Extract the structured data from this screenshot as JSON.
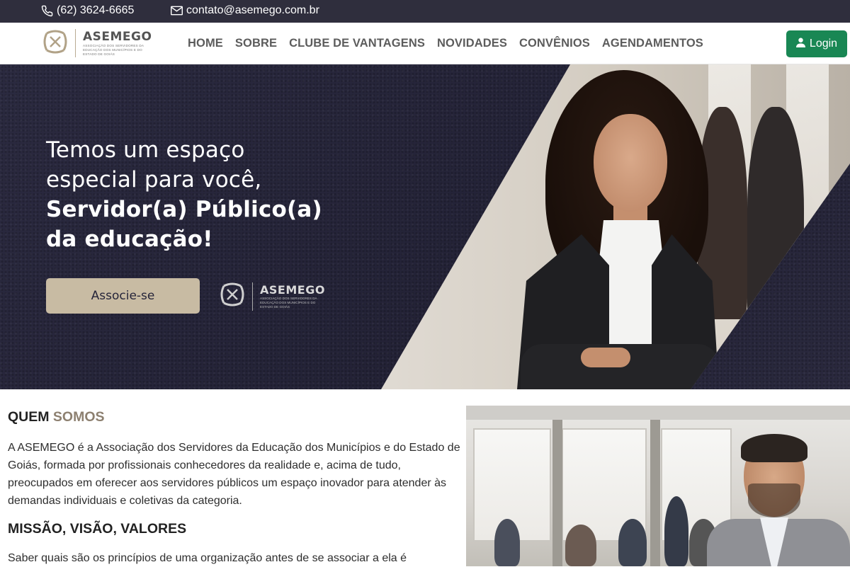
{
  "topbar": {
    "phone": "(62) 3624-6665",
    "email": "contato@asemego.com.br",
    "phone_icon": "phone-icon",
    "email_icon": "envelope-icon"
  },
  "nav": {
    "logo_name": "ASEMEGO",
    "logo_sub": "Associação dos Servidores da Educação dos Municípios e do Estado de Goiás",
    "items": [
      {
        "label": "HOME"
      },
      {
        "label": "SOBRE"
      },
      {
        "label": "CLUBE DE VANTAGENS"
      },
      {
        "label": "NOVIDADES"
      },
      {
        "label": "CONVÊNIOS"
      },
      {
        "label": "AGENDAMENTOS"
      }
    ],
    "login_label": "Login",
    "login_icon": "user-icon"
  },
  "hero": {
    "line1": "Temos um espaço",
    "line2": "especial para você,",
    "line3": "Servidor(a) Público(a)",
    "line4": "da educação!",
    "cta": "Associe-se",
    "logo_name": "ASEMEGO",
    "logo_sub": "Associação dos Servidores da Educação dos Municípios e do Estado de Goiás"
  },
  "about": {
    "title_part1": "QUEM",
    "title_part2": "SOMOS",
    "paragraph": "A ASEMEGO é a Associação dos Servidores da Educação dos Municípios e do Estado de Goiás, formada por profissionais conhecedores da realidade e, acima de tudo, preocupados em oferecer aos servidores públicos um espaço inovador para atender às demandas individuais e coletivas da categoria.",
    "mission_title": "MISSÃO, VISÃO, VALORES",
    "mission_paragraph": "Saber quais são os princípios de uma organização antes de se associar a ela é"
  },
  "colors": {
    "topbar": "#2f2e3d",
    "hero_bg": "#26253a",
    "accent": "#8d8070",
    "cta": "#c8bba3",
    "login": "#198754"
  }
}
